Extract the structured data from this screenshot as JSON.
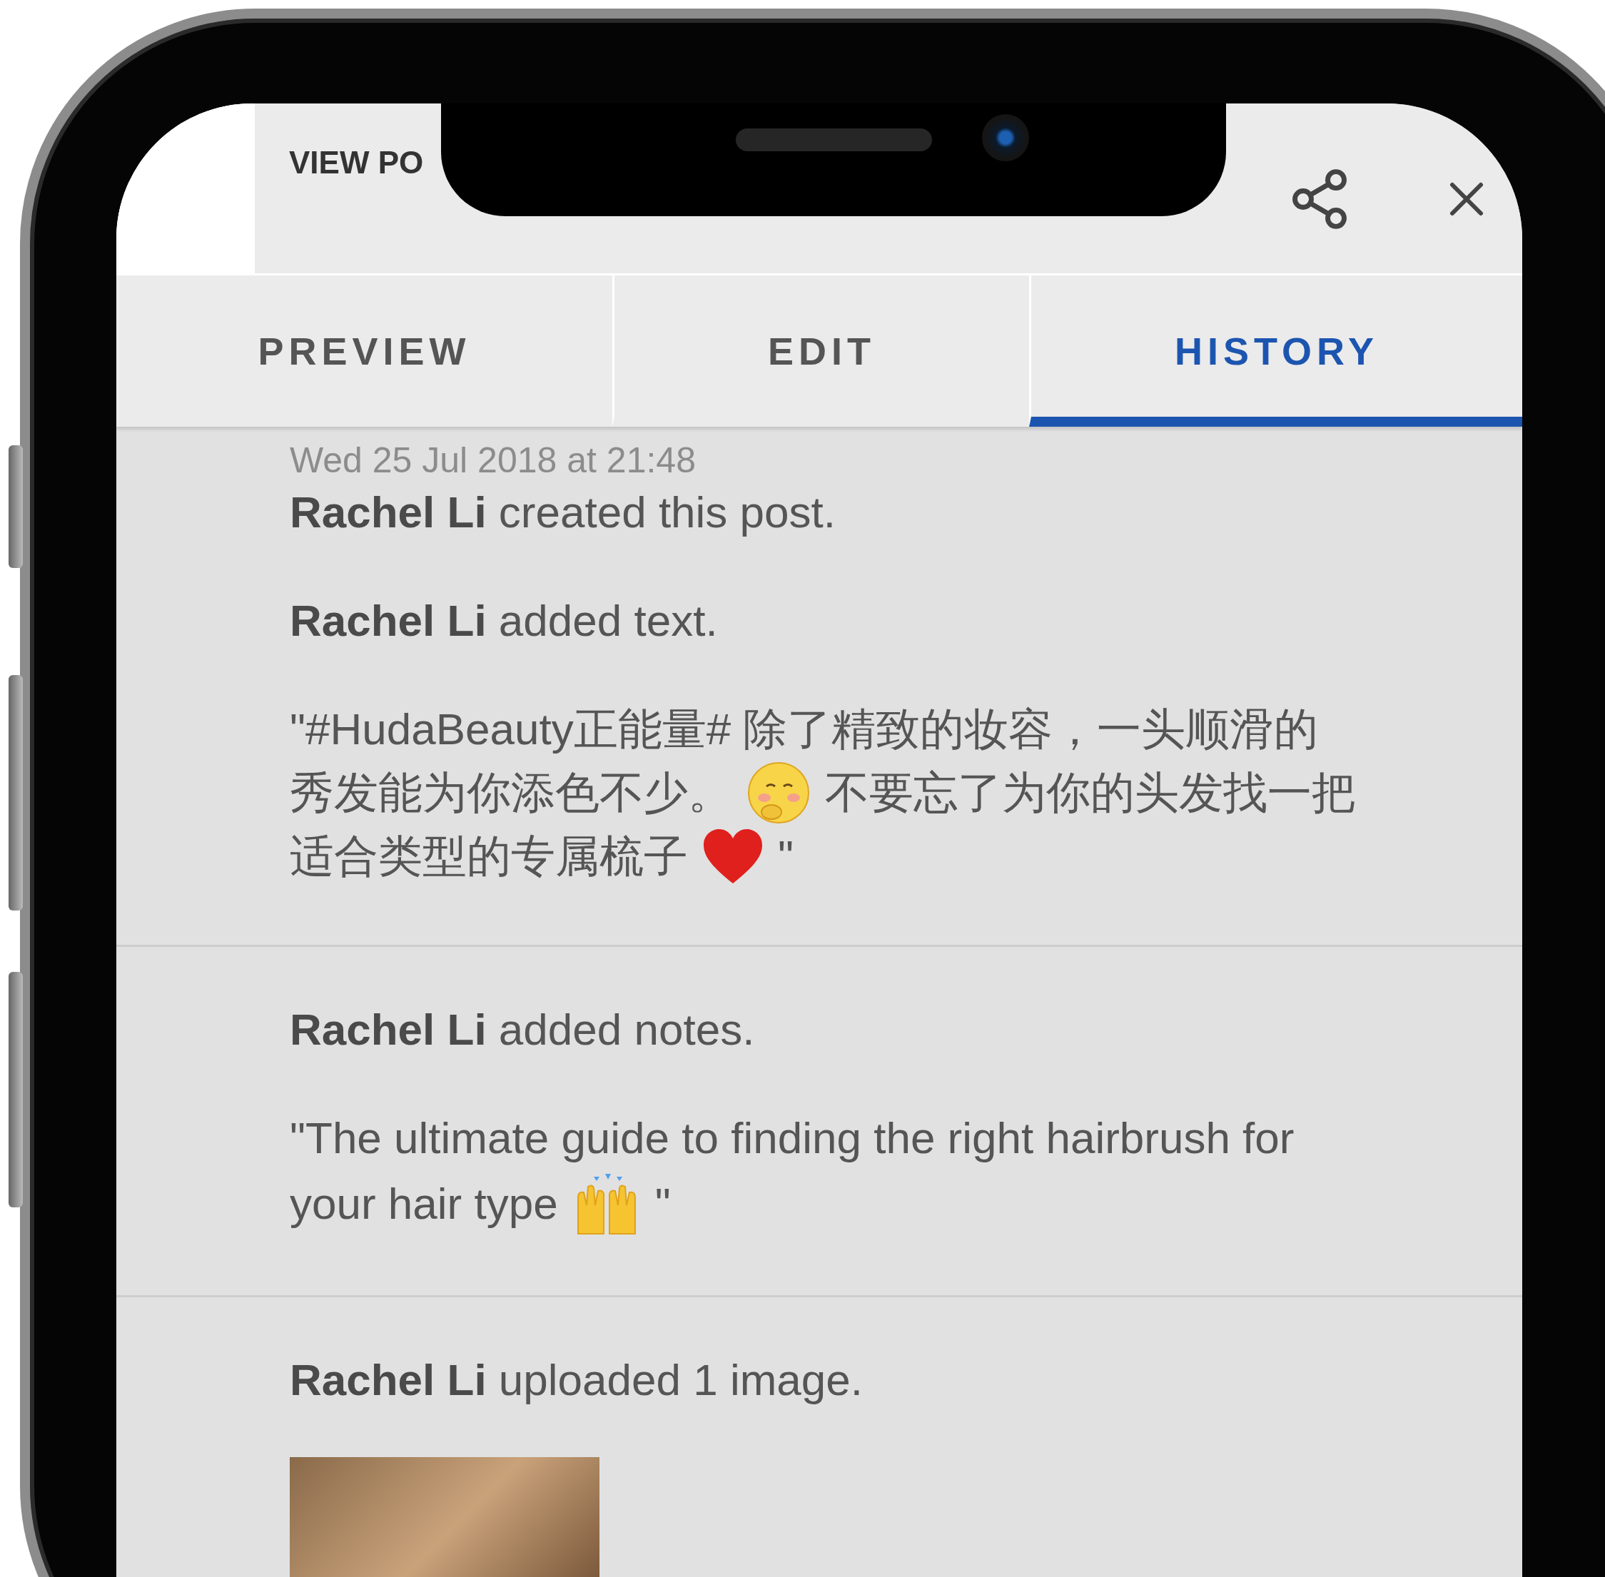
{
  "header": {
    "title": "VIEW PO"
  },
  "tabs": [
    {
      "label": "PREVIEW",
      "selected": false
    },
    {
      "label": "EDIT",
      "selected": false
    },
    {
      "label": "HISTORY",
      "selected": true
    }
  ],
  "entries": [
    {
      "timestamp": "Wed 25 Jul 2018 at 21:48",
      "lines": [
        {
          "kind": "action",
          "text": "**Rachel Li** created this post."
        },
        {
          "kind": "action",
          "text": "**Rachel Li** added text."
        },
        {
          "kind": "quote",
          "rows": [
            [
              {
                "kind": "text",
                "text": "\"#HudaBeauty正能量# 除了精致的妆容，一头顺滑的"
              }
            ],
            [
              {
                "kind": "text",
                "text": "秀发能为你添色不少。"
              },
              {
                "kind": "face"
              },
              {
                "kind": "text",
                "text": "不要忘了为你的头发找一把"
              }
            ],
            [
              {
                "kind": "text",
                "text": "适合类型的专属梳子"
              },
              {
                "kind": "heart"
              },
              {
                "kind": "text",
                "text": "\""
              }
            ]
          ]
        }
      ]
    },
    {
      "lines": [
        {
          "kind": "action",
          "text": "**Rachel Li** added notes."
        },
        {
          "kind": "quote",
          "rows": [
            [
              {
                "kind": "text",
                "text": "\"The ultimate guide to finding the right hairbrush for"
              }
            ],
            [
              {
                "kind": "text",
                "text": "your hair type"
              },
              {
                "kind": "hands"
              },
              {
                "kind": "text",
                "text": "\""
              }
            ]
          ]
        }
      ]
    },
    {
      "lines": [
        {
          "kind": "action",
          "text": "**Rachel Li** uploaded 1 image."
        },
        {
          "kind": "image"
        }
      ]
    }
  ]
}
